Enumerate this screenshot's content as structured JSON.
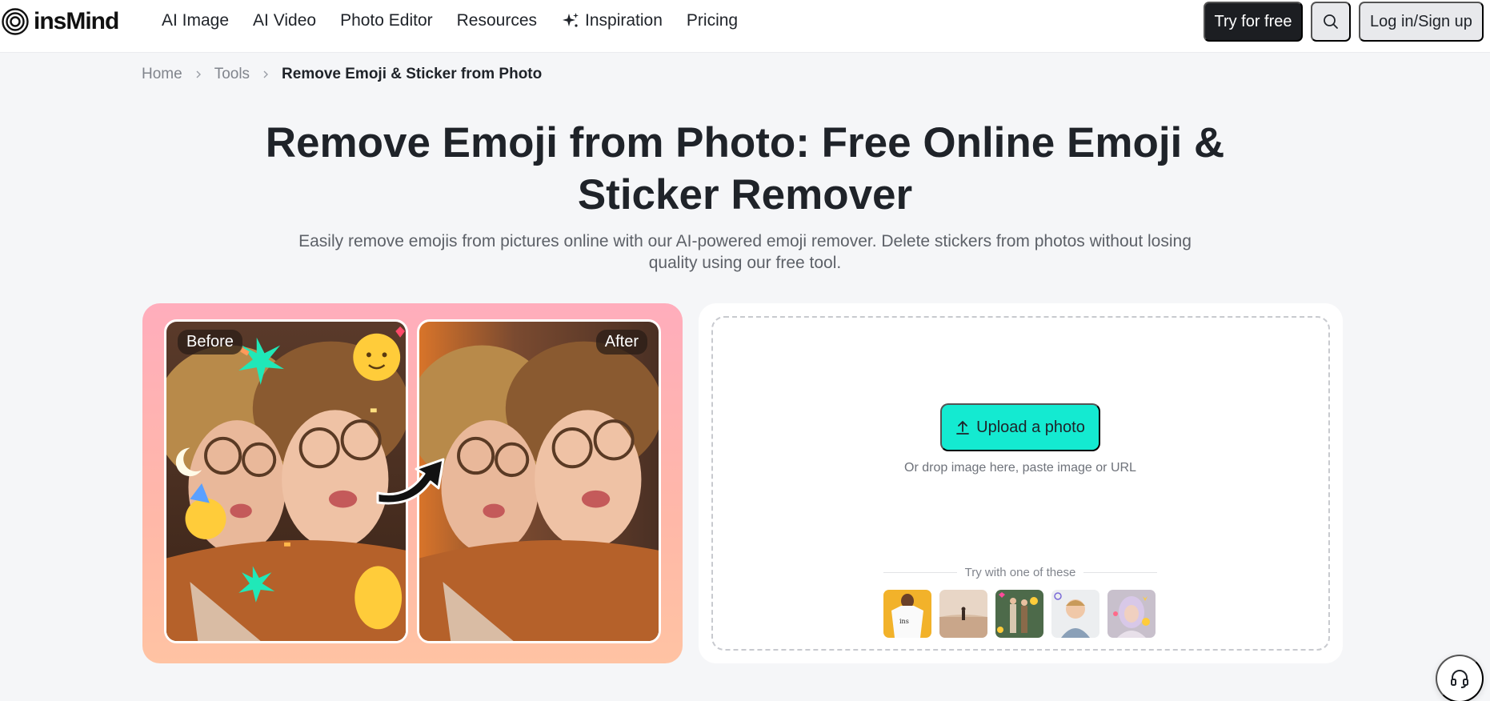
{
  "brand": {
    "name": "insMind"
  },
  "nav": {
    "items": [
      {
        "label": "AI Image"
      },
      {
        "label": "AI Video"
      },
      {
        "label": "Photo Editor"
      },
      {
        "label": "Resources"
      },
      {
        "label": "Inspiration",
        "icon": "sparkle-icon"
      },
      {
        "label": "Pricing"
      }
    ],
    "try_label": "Try for free",
    "search_icon": "search-icon",
    "login_label": "Log in/Sign up"
  },
  "breadcrumb": {
    "items": [
      "Home",
      "Tools"
    ],
    "current": "Remove Emoji & Sticker from Photo"
  },
  "hero": {
    "title_line1": "Remove Emoji from Photo: Free Online Emoji &",
    "title_line2": "Sticker Remover",
    "subtitle_line1": "Easily remove emojis from pictures online with our AI-powered emoji remover. Delete stickers from photos without losing",
    "subtitle_line2": "quality using our free tool."
  },
  "demo": {
    "before_label": "Before",
    "after_label": "After"
  },
  "upload": {
    "button_label": "Upload a photo",
    "button_icon": "upload-icon",
    "hint": "Or drop image here, paste image or URL",
    "samples_label": "Try with one of these"
  },
  "colors": {
    "accent": "#14ead1",
    "dark_button": "#1c1e22",
    "page_bg": "#f5f6f8"
  },
  "support_icon": "headset-icon"
}
